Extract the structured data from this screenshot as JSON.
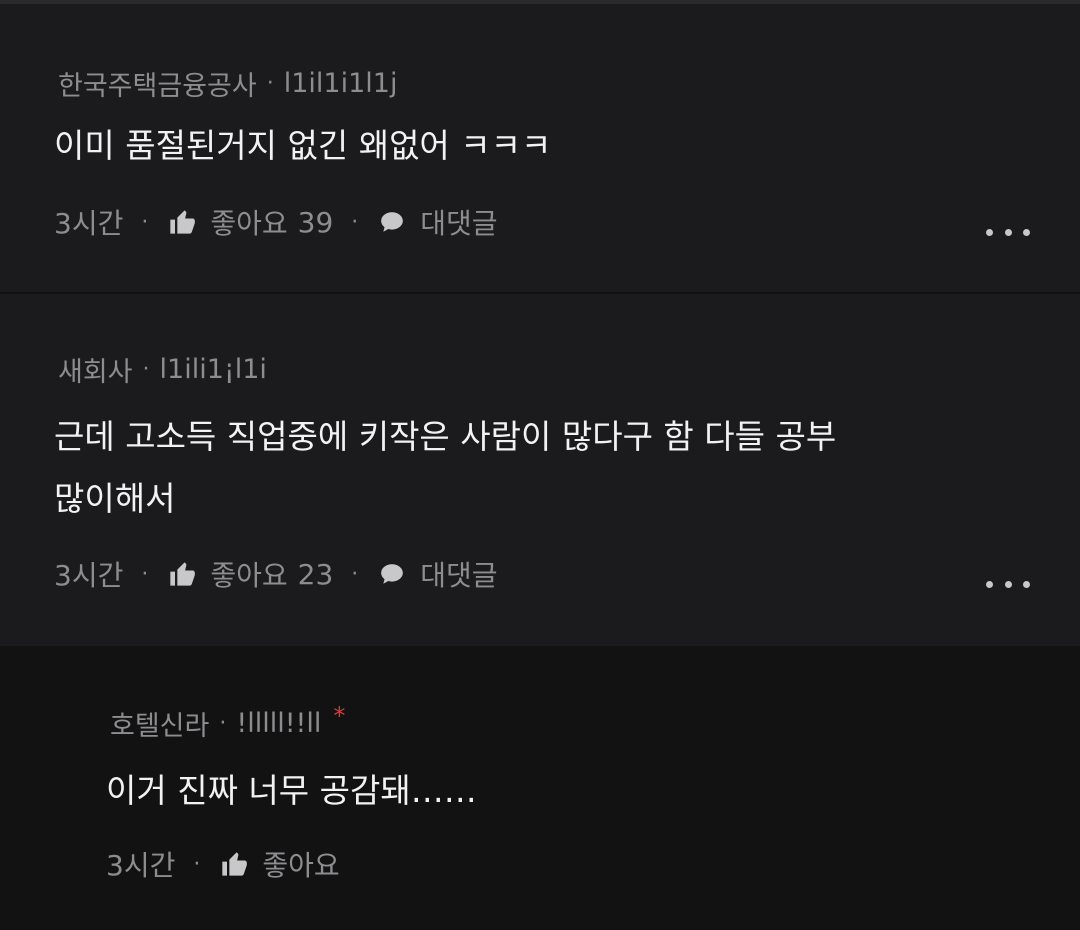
{
  "comments": [
    {
      "author": "한국주택금융공사",
      "handle": "l1il1i1l1j",
      "text_lines": [
        "이미 품절된거지 없긴 왜없어 ㅋㅋㅋ"
      ],
      "time": "3시간",
      "like_label": "좋아요",
      "like_count": "39",
      "reply_label": "대댓글"
    },
    {
      "author": "새회사",
      "handle": "l1ili1¡l1i",
      "text_lines": [
        "근데 고소득 직업중에 키작은 사람이 많다구 함 다들 공부",
        "많이해서"
      ],
      "time": "3시간",
      "like_label": "좋아요",
      "like_count": "23",
      "reply_label": "대댓글"
    },
    {
      "author": "호텔신라",
      "handle": "!lllll!!ll",
      "badge": "*",
      "text_lines": [
        "이거 진짜 너무 공감돼……"
      ],
      "time": "3시간",
      "like_label": "좋아요"
    }
  ],
  "separator": "·",
  "icons": {
    "like": "thumbs-up-icon",
    "reply": "speech-bubble-icon",
    "more": "more-dots-icon"
  },
  "colors": {
    "background": "#1b1b1d",
    "reply_background": "#121213",
    "text": "#f2f2f2",
    "meta": "#8d8d90",
    "badge": "#d33a3a"
  }
}
